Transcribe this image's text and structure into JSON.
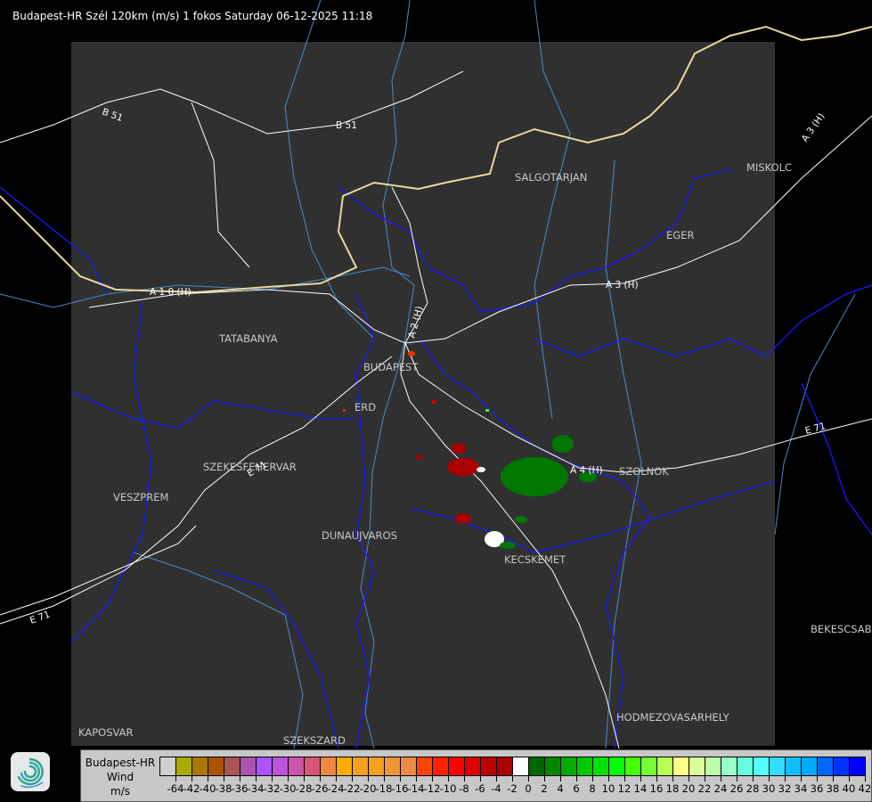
{
  "title": "Budapest-HR Szél 120km (m/s) 1 fokos Saturday 06-12-2025 11:18",
  "map": {
    "cities": [
      "SALGOTARJAN",
      "EGER",
      "MISKOLC",
      "TATABANYA",
      "BUDAPEST",
      "ERD",
      "SZEKESFEHERVAR",
      "VESZPREM",
      "DUNAUJVAROS",
      "KECSKEMET",
      "SZOLNOK",
      "BEKESCSABA",
      "HODMEZOVASARHELY",
      "KAPOSVAR",
      "SZEKSZARD"
    ],
    "roads": [
      "B 51",
      "B 51",
      "A 3 (H)",
      "A 1 0 (H)",
      "A 2 (H)",
      "A 4 (H)",
      "E 71",
      "E 71",
      "E 71",
      "A 3 (H)"
    ],
    "colors": {
      "background": "#000000",
      "radar_area": "#303030",
      "roads": "#ffffff",
      "borders": "#1a1aff",
      "rivers": "#4a8acb",
      "city_labels": "#c8c8c8"
    }
  },
  "logo": {
    "icon": "swirl-logo-icon"
  },
  "legend": {
    "line1": "Budapest-HR",
    "line2": "Wind",
    "line3": "m/s",
    "labels": [
      "-64",
      "-42",
      "-40",
      "-38",
      "-36",
      "-34",
      "-32",
      "-30",
      "-28",
      "-26",
      "-24",
      "-22",
      "-20",
      "-18",
      "-16",
      "-14",
      "-12",
      "-10",
      "-8",
      "-6",
      "-4",
      "-2",
      "0",
      "2",
      "4",
      "6",
      "8",
      "10",
      "12",
      "14",
      "16",
      "18",
      "20",
      "22",
      "24",
      "26",
      "28",
      "30",
      "32",
      "34",
      "36",
      "38",
      "40",
      "42"
    ],
    "colors": [
      "#d0d0d0",
      "#aaaa00",
      "#aa7700",
      "#aa5500",
      "#aa5555",
      "#aa55aa",
      "#aa55ff",
      "#bb55dd",
      "#cc55aa",
      "#d85577",
      "#ee8844",
      "#ffaa00",
      "#f5a020",
      "#f5a020",
      "#f09535",
      "#ee8844",
      "#ff4400",
      "#ff2200",
      "#ff0000",
      "#dd0000",
      "#bb0000",
      "#aa0000",
      "#ffffff",
      "#006600",
      "#008800",
      "#00aa00",
      "#00c800",
      "#00e000",
      "#00ff00",
      "#44ff00",
      "#77ff33",
      "#bbff55",
      "#ffff88",
      "#ddff99",
      "#bbffaa",
      "#99ffcc",
      "#66ffdd",
      "#55ffff",
      "#33ddff",
      "#11bbff",
      "#00aaff",
      "#0066ff",
      "#0033ff",
      "#0000ff"
    ]
  }
}
